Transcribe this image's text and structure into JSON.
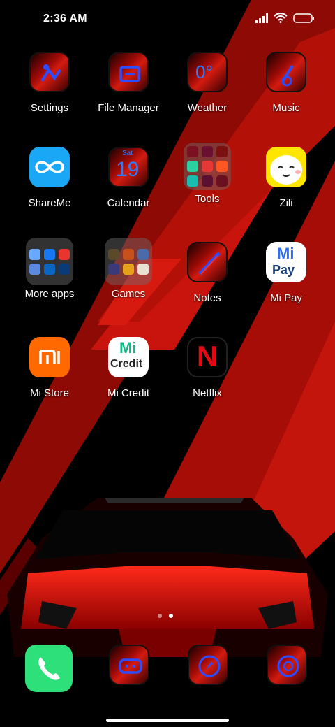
{
  "status": {
    "time": "2:36 AM",
    "icons": [
      "signal-icon",
      "wifi-icon",
      "battery-icon"
    ]
  },
  "apps": [
    {
      "label": "Settings",
      "icon": "settings-icon"
    },
    {
      "label": "File Manager",
      "icon": "folder-icon"
    },
    {
      "label": "Weather",
      "icon": "weather-icon",
      "glyph": "0°"
    },
    {
      "label": "Music",
      "icon": "music-icon"
    },
    {
      "label": "ShareMe",
      "icon": "shareme-icon"
    },
    {
      "label": "Calendar",
      "icon": "calendar-icon",
      "glyph_small": "Sat",
      "glyph": "19"
    },
    {
      "label": "Tools",
      "icon": "tools-folder-icon"
    },
    {
      "label": "Zili",
      "icon": "zili-icon"
    },
    {
      "label": "More apps",
      "icon": "more-apps-folder-icon"
    },
    {
      "label": "Games",
      "icon": "games-folder-icon"
    },
    {
      "label": "Notes",
      "icon": "notes-icon"
    },
    {
      "label": "Mi Pay",
      "icon": "mipay-icon",
      "glyph_top": "Mi",
      "glyph": "Pay"
    },
    {
      "label": "Mi Store",
      "icon": "mi-store-icon"
    },
    {
      "label": "Mi Credit",
      "icon": "mi-credit-icon",
      "glyph_top": "Mi",
      "glyph": "Credit"
    },
    {
      "label": "Netflix",
      "icon": "netflix-icon",
      "glyph": "N"
    }
  ],
  "page_indicator": {
    "pages": 2,
    "active": 2
  },
  "dock": [
    {
      "name": "phone-icon"
    },
    {
      "name": "messaging-icon"
    },
    {
      "name": "browser-icon"
    },
    {
      "name": "camera-icon"
    }
  ],
  "colors": {
    "accent_red": "#d31b10",
    "theme_blue": "#2c4cff",
    "shareme_blue": "#1aa7f5",
    "mi_orange": "#ff6900",
    "phone_green": "#2ee07a",
    "netflix_red": "#e50914"
  }
}
